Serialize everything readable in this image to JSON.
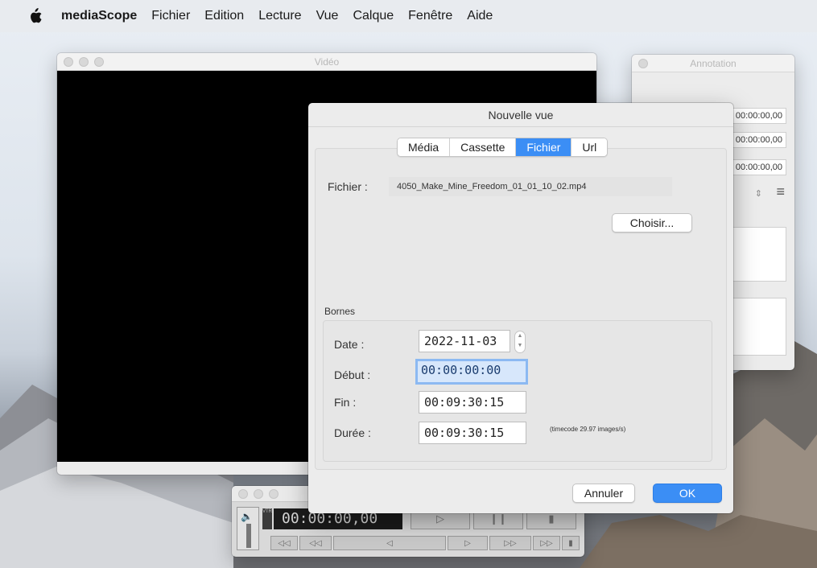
{
  "menubar": {
    "app_name": "mediaScope",
    "items": [
      "Fichier",
      "Edition",
      "Lecture",
      "Vue",
      "Calque",
      "Fenêtre",
      "Aide"
    ]
  },
  "video_window": {
    "title": "Vidéo"
  },
  "annotation_window": {
    "title": "Annotation",
    "fields": [
      "00:00:00,00",
      "00:00:00,00",
      "00:00:00,00"
    ]
  },
  "transport": {
    "timecode": "00:00:00,00",
    "vtr_label": "VTR"
  },
  "dialog": {
    "title": "Nouvelle vue",
    "tabs": [
      "Média",
      "Cassette",
      "Fichier",
      "Url"
    ],
    "active_tab": "Fichier",
    "file_label": "Fichier :",
    "file_value": "4050_Make_Mine_Freedom_01_01_10_02.mp4",
    "choose_button": "Choisir...",
    "bounds_label": "Bornes",
    "date_label": "Date :",
    "date_value": "2022-11-03",
    "start_label": "Début :",
    "start_value": "00:00:00:00",
    "end_label": "Fin :",
    "end_value": "00:09:30:15",
    "duration_label": "Durée :",
    "duration_value": "00:09:30:15",
    "timecode_note": "(timecode 29.97 images/s)",
    "cancel_button": "Annuler",
    "ok_button": "OK"
  },
  "colors": {
    "accent": "#3b8ef5",
    "focus_field": "#d7e7fb"
  }
}
